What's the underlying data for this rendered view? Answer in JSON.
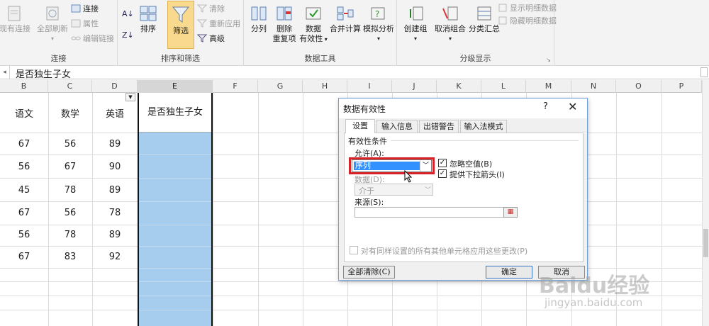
{
  "ribbon": {
    "connections": {
      "existing": "现有连接",
      "refresh_all": "全部刷新",
      "connections": "连接",
      "properties": "属性",
      "edit_links": "编辑链接",
      "group_label": "连接"
    },
    "sort_filter": {
      "sort": "排序",
      "filter": "筛选",
      "clear": "清除",
      "reapply": "重新应用",
      "advanced": "高级",
      "group_label": "排序和筛选"
    },
    "data_tools": {
      "split": "分列",
      "remove_dup_1": "删除",
      "remove_dup_2": "重复项",
      "validation_1": "数据",
      "validation_2": "有效性",
      "consolidate": "合并计算",
      "whatif": "模拟分析",
      "group_label": "数据工具"
    },
    "outline": {
      "group": "创建组",
      "ungroup": "取消组合",
      "subtotal": "分类汇总",
      "show_detail": "显示明细数据",
      "hide_detail": "隐藏明细数据",
      "group_label": "分级显示"
    }
  },
  "formula_bar": {
    "content": "是否独生子女"
  },
  "columns": [
    "B",
    "C",
    "D",
    "E",
    "F",
    "G",
    "H",
    "I",
    "J",
    "K",
    "L",
    "M",
    "N",
    "O",
    "P"
  ],
  "table": {
    "headers": [
      "语文",
      "数学",
      "英语",
      "是否独生子女"
    ],
    "rows": [
      [
        "67",
        "56",
        "89"
      ],
      [
        "56",
        "67",
        "90"
      ],
      [
        "45",
        "78",
        "89"
      ],
      [
        "67",
        "56",
        "78"
      ],
      [
        "56",
        "78",
        "89"
      ],
      [
        "67",
        "83",
        "92"
      ]
    ]
  },
  "dialog": {
    "title": "数据有效性",
    "help": "?",
    "close": "✕",
    "tabs": [
      "设置",
      "输入信息",
      "出错警告",
      "输入法模式"
    ],
    "section_title": "有效性条件",
    "allow_label": "允许(A):",
    "allow_value": "序列",
    "ignore_blank": "忽略空值(B)",
    "dropdown": "提供下拉箭头(I)",
    "data_label": "数据(D):",
    "data_value": "介于",
    "source_label": "来源(S):",
    "source_value": "",
    "apply_all": "对有同样设置的所有其他单元格应用这些更改(P)",
    "clear_all": "全部清除(C)",
    "ok": "确定",
    "cancel": "取消"
  },
  "watermark": {
    "logo": "Baidu经验",
    "url": "jingyan.baidu.com"
  }
}
